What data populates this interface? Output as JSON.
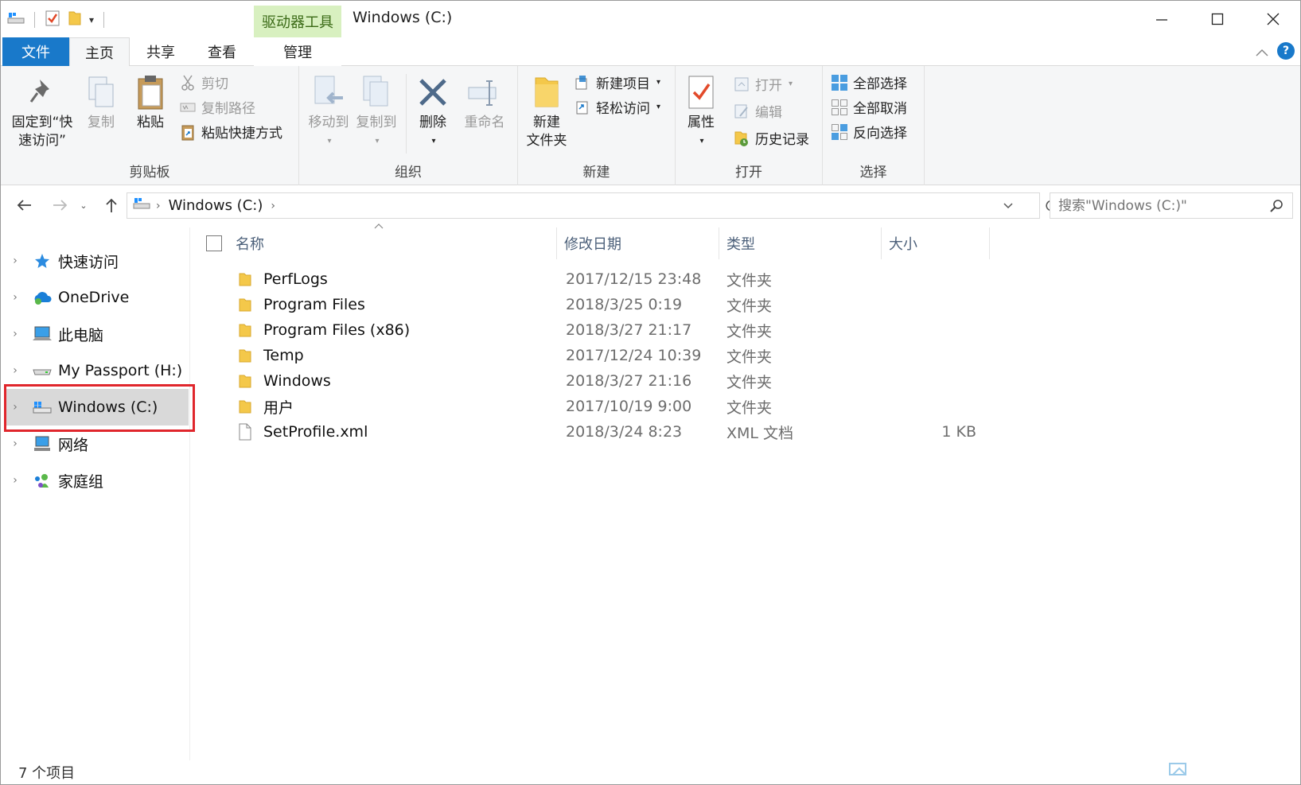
{
  "window": {
    "title": "Windows (C:)",
    "context_tab_header": "驱动器工具"
  },
  "tabs": {
    "file": "文件",
    "home": "主页",
    "share": "共享",
    "view": "查看",
    "manage": "管理"
  },
  "ribbon": {
    "clipboard": {
      "label": "剪贴板",
      "pin": "固定到“快速访问”",
      "pin_line1": "固定到“快",
      "pin_line2": "速访问”",
      "copy": "复制",
      "paste": "粘贴",
      "cut": "剪切",
      "copy_path": "复制路径",
      "paste_shortcut": "粘贴快捷方式"
    },
    "organize": {
      "label": "组织",
      "move_to": "移动到",
      "copy_to": "复制到",
      "delete": "删除",
      "rename": "重命名"
    },
    "new": {
      "label": "新建",
      "new_folder_line1": "新建",
      "new_folder_line2": "文件夹",
      "new_item": "新建项目",
      "easy_access": "轻松访问"
    },
    "open": {
      "label": "打开",
      "properties": "属性",
      "open": "打开",
      "edit": "编辑",
      "history": "历史记录"
    },
    "select": {
      "label": "选择",
      "select_all": "全部选择",
      "select_none": "全部取消",
      "invert": "反向选择"
    }
  },
  "address": {
    "path": "Windows (C:)",
    "search_placeholder": "搜索\"Windows (C:)\""
  },
  "nav": {
    "items": [
      {
        "label": "快速访问"
      },
      {
        "label": "OneDrive"
      },
      {
        "label": "此电脑"
      },
      {
        "label": "My Passport (H:)"
      },
      {
        "label": "Windows (C:)"
      },
      {
        "label": "网络"
      },
      {
        "label": "家庭组"
      }
    ]
  },
  "files": {
    "columns": {
      "name": "名称",
      "date": "修改日期",
      "type": "类型",
      "size": "大小"
    },
    "rows": [
      {
        "name": "PerfLogs",
        "date": "2017/12/15 23:48",
        "type": "文件夹",
        "size": ""
      },
      {
        "name": "Program Files",
        "date": "2018/3/25 0:19",
        "type": "文件夹",
        "size": ""
      },
      {
        "name": "Program Files (x86)",
        "date": "2018/3/27 21:17",
        "type": "文件夹",
        "size": ""
      },
      {
        "name": "Temp",
        "date": "2017/12/24 10:39",
        "type": "文件夹",
        "size": ""
      },
      {
        "name": "Windows",
        "date": "2018/3/27 21:16",
        "type": "文件夹",
        "size": ""
      },
      {
        "name": "用户",
        "date": "2017/10/19 9:00",
        "type": "文件夹",
        "size": ""
      },
      {
        "name": "SetProfile.xml",
        "date": "2018/3/24 8:23",
        "type": "XML 文档",
        "size": "1 KB"
      }
    ]
  },
  "status": {
    "count": "7 个项目"
  },
  "colors": {
    "file_tab": "#1979ca",
    "context_tab": "#d8f0c0",
    "highlight": "#e0262c",
    "folder": "#f4c84a"
  }
}
